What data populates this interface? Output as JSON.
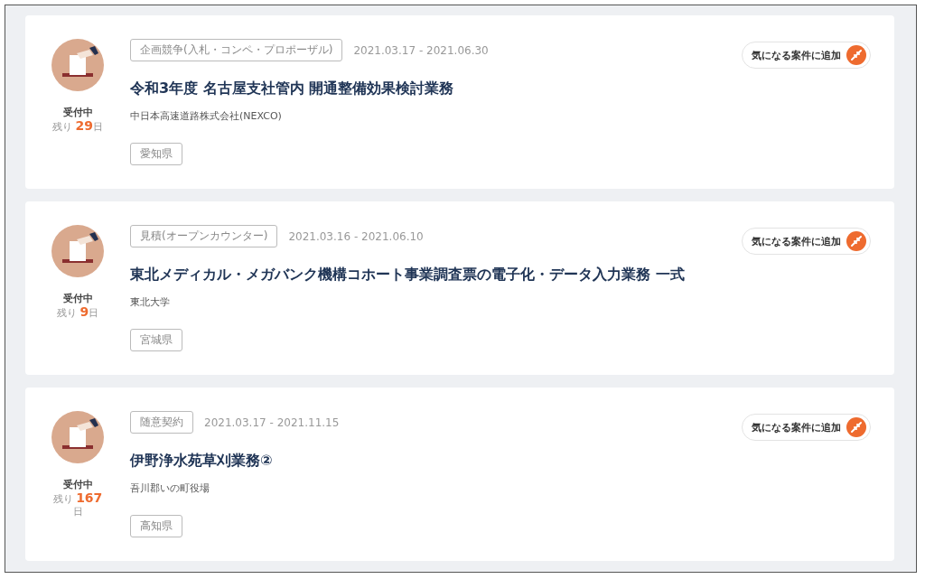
{
  "listings": [
    {
      "status": "受付中",
      "remaining_label": "残り",
      "remaining_days": "29",
      "remaining_unit": "日",
      "category": "企画競争(入札・コンペ・プロポーザル)",
      "period": "2021.03.17 - 2021.06.30",
      "title": "令和3年度 名古屋支社管内 開通整備効果検討業務",
      "organization": "中日本高速道路株式会社(NEXCO)",
      "prefecture": "愛知県",
      "bookmark_label": "気になる案件に追加"
    },
    {
      "status": "受付中",
      "remaining_label": "残り",
      "remaining_days": "9",
      "remaining_unit": "日",
      "category": "見積(オープンカウンター)",
      "period": "2021.03.16 - 2021.06.10",
      "title": "東北メディカル・メガバンク機構コホート事業調査票の電子化・データ入力業務 一式",
      "organization": "東北大学",
      "prefecture": "宮城県",
      "bookmark_label": "気になる案件に追加"
    },
    {
      "status": "受付中",
      "remaining_label": "残り",
      "remaining_days": "167",
      "remaining_unit": "日",
      "category": "随意契約",
      "period": "2021.03.17 - 2021.11.15",
      "title": "伊野浄水苑草刈業務②",
      "organization": "吾川郡いの町役場",
      "prefecture": "高知県",
      "bookmark_label": "気になる案件に追加"
    }
  ]
}
